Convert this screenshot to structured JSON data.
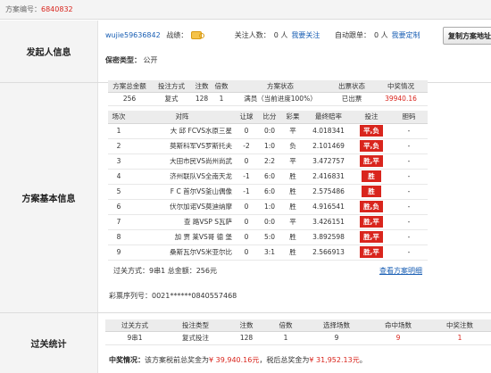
{
  "top": {
    "label": "方案编号：",
    "value": "6840832"
  },
  "sections": {
    "initiator": "发起人信息",
    "basic": "方案基本信息",
    "stats": "过关统计"
  },
  "initiator": {
    "user": "wujie59636842",
    "record_label": "战绩：",
    "followers_label": "关注人数：",
    "followers": "0 人",
    "follow_link": "我要关注",
    "auto_label": "自动跟单：",
    "auto": "0 人",
    "auto_link": "我要定制",
    "privacy_label": "保密类型：",
    "privacy": "公开",
    "copy_button": "复制方案地址"
  },
  "plan": {
    "headers": [
      "方案总金额",
      "投注方式",
      "注数",
      "倍数",
      "方案状态",
      "出票状态",
      "中奖情况"
    ],
    "row": [
      "256",
      "复式",
      "128",
      "1",
      "满员（当前进度100%）",
      "已出票",
      "39940.16"
    ]
  },
  "matches": {
    "headers": [
      "场次",
      "对阵",
      "让球",
      "比分",
      "彩果",
      "最终赔率",
      "投注",
      "胆码"
    ],
    "rows": [
      [
        "1",
        "大 邱 FCVS水原三星",
        "0",
        "0:0",
        "平",
        "4.018341",
        "平,负",
        "-"
      ],
      [
        "2",
        "莫斯科军VS罗斯托夫",
        "-2",
        "1:0",
        "负",
        "2.101469",
        "平,负",
        "-"
      ],
      [
        "3",
        "大田市民VS尚州尚武",
        "0",
        "2:2",
        "平",
        "3.472757",
        "胜,平",
        "-"
      ],
      [
        "4",
        "济州联队VS全南天龙",
        "-1",
        "6:0",
        "胜",
        "2.416831",
        "胜",
        "-"
      ],
      [
        "5",
        "F C 首尔VS釜山偶像",
        "-1",
        "6:0",
        "胜",
        "2.575486",
        "胜",
        "-"
      ],
      [
        "6",
        "伏尔加诺VS莫迪纳摩",
        "0",
        "1:0",
        "胜",
        "4.916541",
        "胜,负",
        "-"
      ],
      [
        "7",
        "查 路VSP S瓦萨",
        "0",
        "0:0",
        "平",
        "3.426151",
        "胜,平",
        "-"
      ],
      [
        "8",
        "加 贾 莱VS哥 德 堡",
        "0",
        "5:0",
        "胜",
        "3.892598",
        "胜,平",
        "-"
      ],
      [
        "9",
        "桑斯瓦尔VS米亚尔比",
        "0",
        "3:1",
        "胜",
        "2.566913",
        "胜,平",
        "-"
      ]
    ],
    "pass_info": "过关方式：9串1 总金额：256元",
    "detail_link": "查看方案明细",
    "ticket_seq": "彩票序列号：0021******0840557468"
  },
  "stats": {
    "headers": [
      "过关方式",
      "投注类型",
      "注数",
      "倍数",
      "选择场数",
      "命中场数",
      "中奖注数"
    ],
    "row": [
      "9串1",
      "复式投注",
      "128",
      "1",
      "9",
      "9",
      "1"
    ],
    "prize_label": "中奖情况：",
    "prize_pre": "该方案税前总奖金为",
    "prize_pre_amount": "¥ 39,940.16元",
    "prize_post": "，税后总奖金为",
    "prize_post_amount": "¥ 31,952.13元",
    "prize_end": "。"
  }
}
